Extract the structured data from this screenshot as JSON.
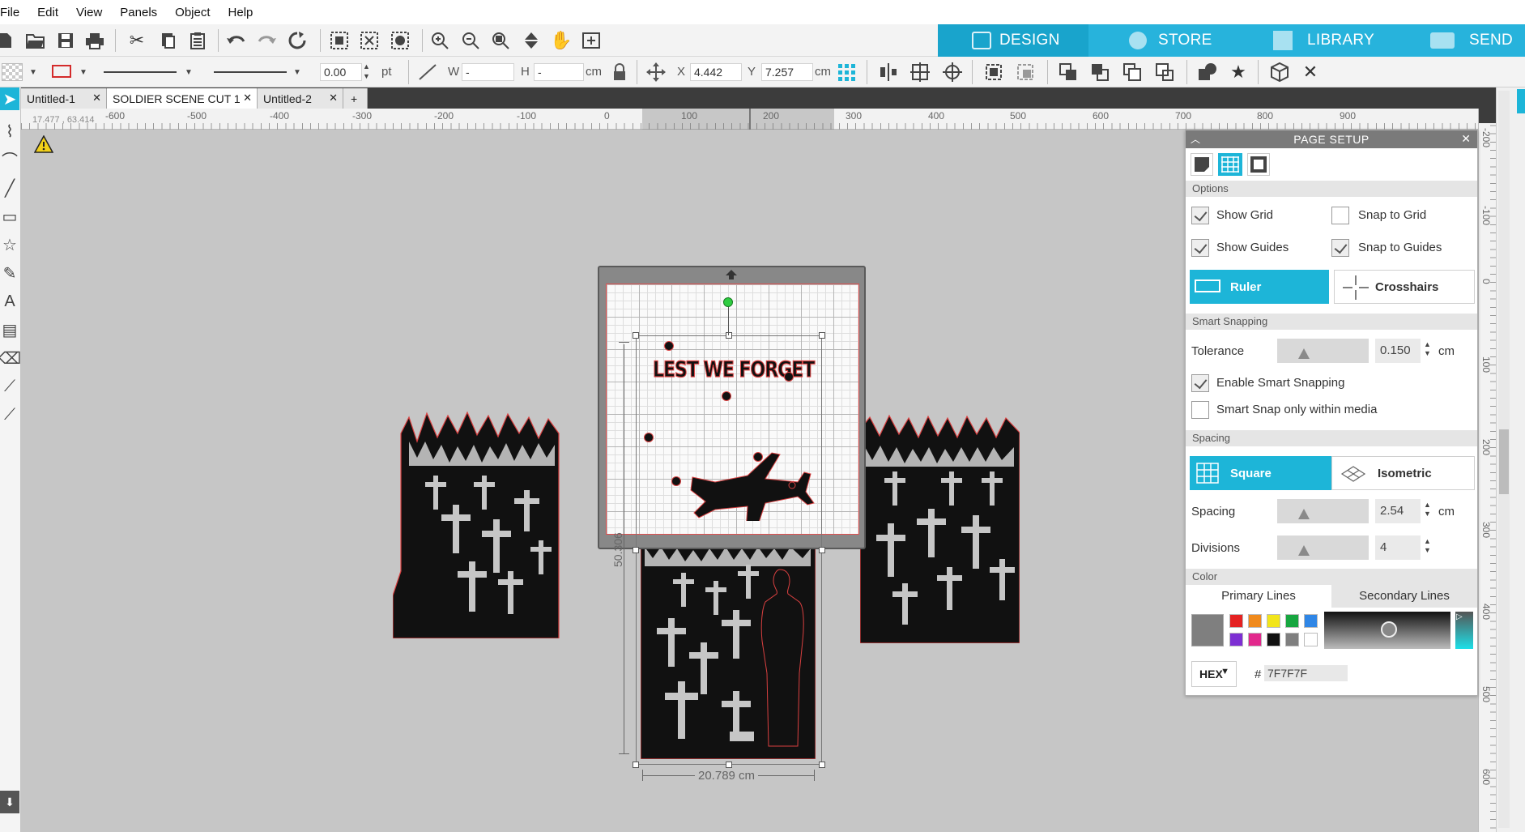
{
  "menu": [
    "File",
    "Edit",
    "View",
    "Panels",
    "Object",
    "Help"
  ],
  "nav_tabs": [
    {
      "label": "DESIGN",
      "active": true
    },
    {
      "label": "STORE",
      "active": false
    },
    {
      "label": "LIBRARY",
      "active": false
    },
    {
      "label": "SEND",
      "active": false
    }
  ],
  "colors": {
    "accent": "#1db5d8",
    "design_tab": "#19a4cc",
    "inactive_tab": "#27b3dc"
  },
  "props": {
    "stroke_width": "0.00",
    "stroke_unit": "pt",
    "w_label": "W",
    "w_value": "-",
    "h_label": "H",
    "h_value": "-",
    "size_unit": "cm",
    "x_label": "X",
    "x_value": "4.442",
    "y_label": "Y",
    "y_value": "7.257",
    "pos_unit": "cm"
  },
  "doc_tabs": [
    "Untitled-1",
    "SOLDIER SCENE CUT 1",
    "Untitled-2"
  ],
  "add_tab": "+",
  "coord_readout": "17.477 , 63.414",
  "h_ruler_labels": [
    "-600",
    "-500",
    "-400",
    "-300",
    "-200",
    "-100",
    "0",
    "100",
    "200",
    "300",
    "400",
    "500",
    "600",
    "700",
    "800",
    "900"
  ],
  "v_ruler_labels": [
    "-200",
    "-100",
    "0",
    "100",
    "200",
    "300",
    "400",
    "500",
    "600"
  ],
  "canvas": {
    "title_text": "LEST WE FORGET",
    "dim_width": "20.789 cm",
    "dim_height": "50.306"
  },
  "page_setup": {
    "title": "PAGE SETUP",
    "options_label": "Options",
    "show_grid": "Show Grid",
    "snap_to_grid": "Snap to Grid",
    "show_guides": "Show Guides",
    "snap_to_guides": "Snap to Guides",
    "ruler_btn": "Ruler",
    "crosshairs_btn": "Crosshairs",
    "smart_snapping_label": "Smart Snapping",
    "tolerance_label": "Tolerance",
    "tolerance_value": "0.150",
    "tolerance_unit": "cm",
    "enable_smart": "Enable Smart Snapping",
    "smart_within": "Smart Snap only within media",
    "spacing_section": "Spacing",
    "square_btn": "Square",
    "isometric_btn": "Isometric",
    "spacing_label": "Spacing",
    "spacing_value": "2.54",
    "spacing_unit": "cm",
    "divisions_label": "Divisions",
    "divisions_value": "4",
    "color_section": "Color",
    "primary_lines": "Primary Lines",
    "secondary_lines": "Secondary Lines",
    "hex_label": "HEX",
    "hash": "#",
    "hex_value": "7F7F7F",
    "checks": {
      "show_grid": true,
      "snap_to_grid": false,
      "show_guides": true,
      "snap_to_guides": true,
      "enable_smart": true,
      "smart_within": false
    },
    "swatches": [
      "#e52222",
      "#f08a1c",
      "#f2e51a",
      "#17a640",
      "#2f86e6",
      "#7d2fd3",
      "#e2288c",
      "#111111",
      "#7f7f7f",
      "#ffffff"
    ],
    "current_color": "#7f7f7f"
  }
}
